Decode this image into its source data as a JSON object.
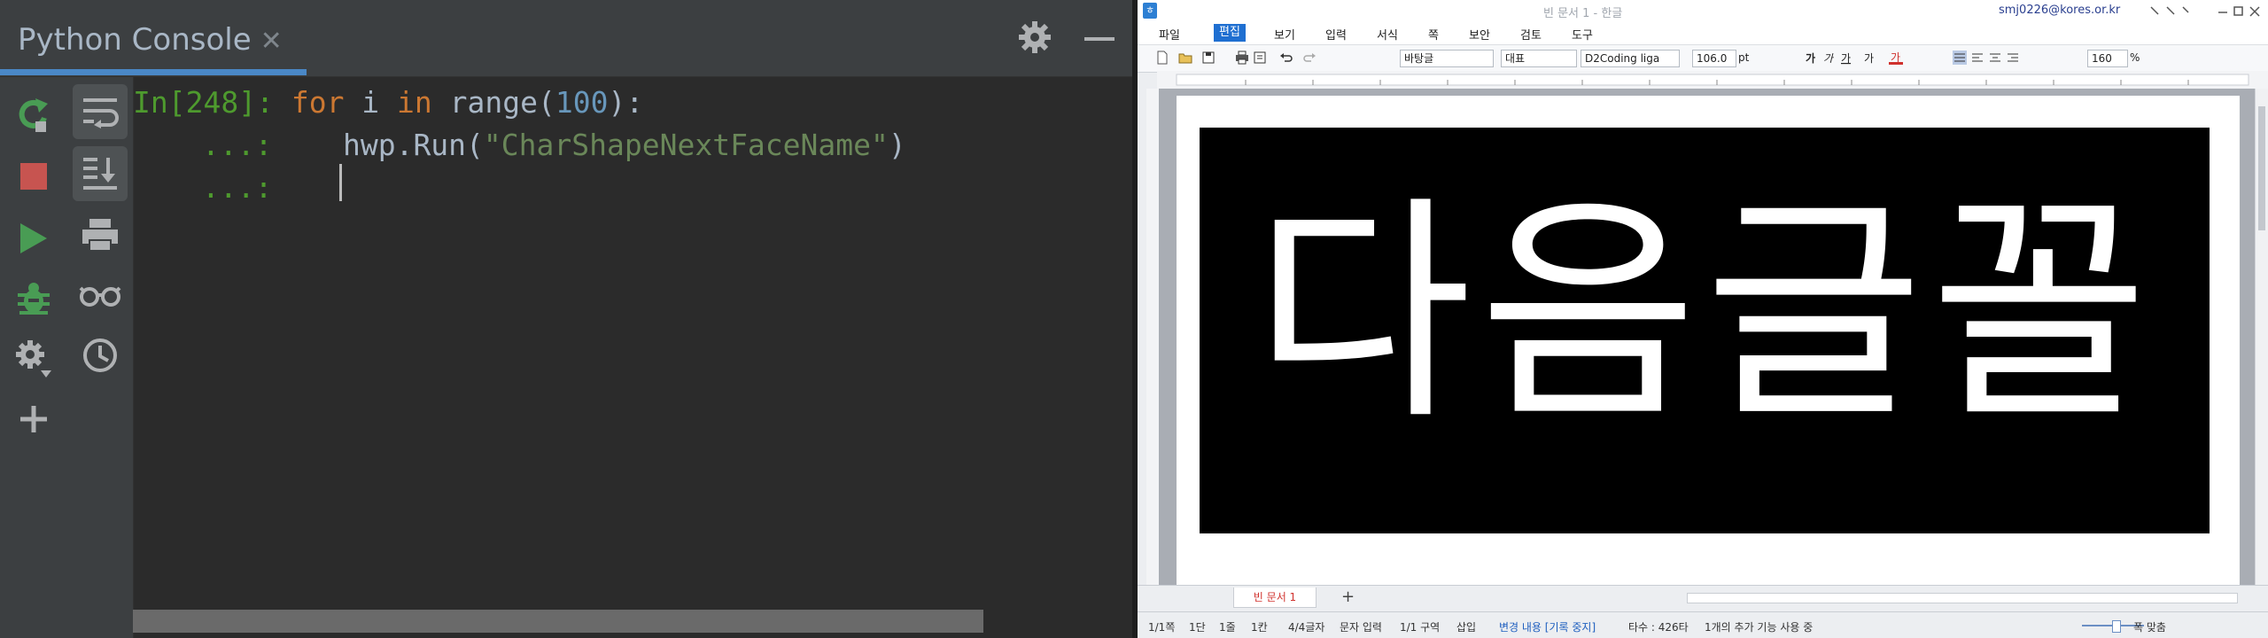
{
  "console": {
    "tab_title": "Python Console",
    "tab_close": "✕",
    "lines": [
      {
        "prompt": "In[248]:",
        "kw1": "for",
        "t1": " i ",
        "kw2": "in",
        "t2": " range(",
        "num": "100",
        "t3": "):"
      },
      {
        "prompt": "...:",
        "code_a": "hwp.Run(",
        "string": "\"CharShapeNextFaceName\"",
        "code_b": ")"
      },
      {
        "prompt": "...:"
      }
    ],
    "colors": {
      "background": "#2b2b2b",
      "keyword": "#cc7832",
      "number": "#6897bb",
      "string": "#6a8759",
      "prompt": "#4e9a2e"
    },
    "toolbar_icons": [
      "rerun-icon",
      "stop-icon",
      "run-icon",
      "debug-icon",
      "settings-icon",
      "add-icon",
      "soft-wrap-icon",
      "scroll-to-end-icon",
      "print-icon",
      "show-variables-icon",
      "history-icon"
    ]
  },
  "hwp": {
    "window_title": "빈 문서 1 - 한글",
    "user": "smj0226@kores.or.kr",
    "menus": [
      "파일",
      "편집",
      "보기",
      "입력",
      "서식",
      "쪽",
      "보안",
      "검토",
      "도구"
    ],
    "active_menu": "편집",
    "toolbar": {
      "style": "바탕글",
      "lang": "대표",
      "font": "D2Coding liga",
      "size": "106.0",
      "unit": "pt",
      "zoom": "160",
      "zoom_unit": "%"
    },
    "document_text": "다음글꼴",
    "doc_tab": "빈 문서 1",
    "add_tab": "+",
    "status": {
      "page": "1/1쪽",
      "section_num": "1단",
      "line": "1줄",
      "col": "1칸",
      "chars": "4/4글자",
      "input_mode": "문자 입력",
      "section": "1/1 구역",
      "insert": "삽입",
      "track": "변경 내용 [기록 중지]",
      "typing": "타수 : 426타",
      "addons": "1개의 추가 기능 사용 중",
      "fit": "폭 맞춤"
    }
  }
}
